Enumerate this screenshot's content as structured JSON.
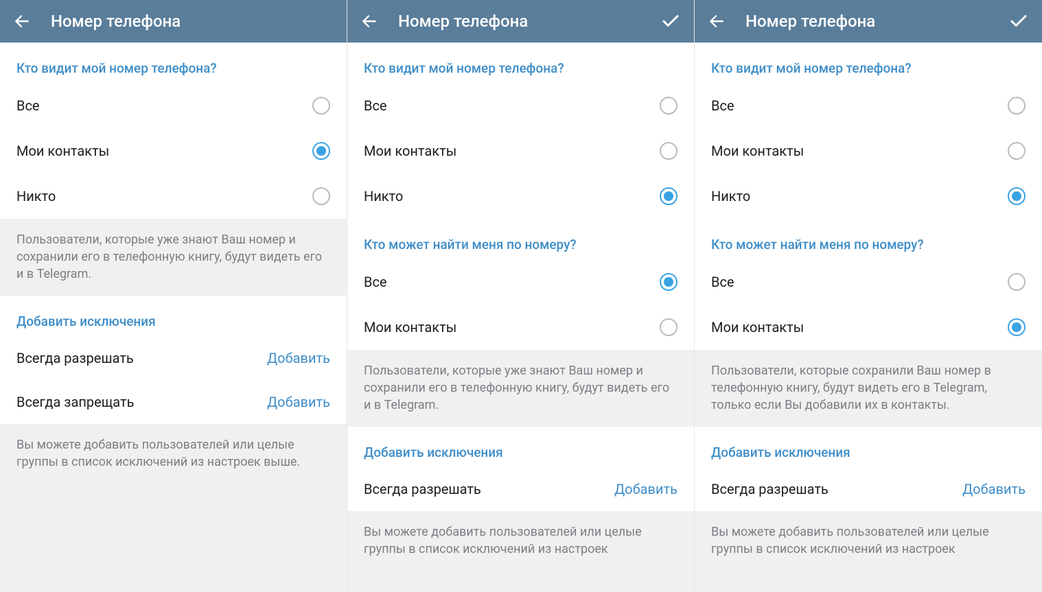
{
  "colors": {
    "header_bg": "#5a7d9a",
    "accent": "#3f8ec8",
    "radio_checked": "#3aa3e3",
    "muted_bg": "#f0f0f0",
    "muted_text": "#7b7f84",
    "text": "#1d1d1d"
  },
  "panels": [
    {
      "header": {
        "title": "Номер телефона",
        "show_check": false
      },
      "who_sees": {
        "title": "Кто видит мой номер телефона?",
        "options": [
          {
            "label": "Все",
            "checked": false
          },
          {
            "label": "Мои контакты",
            "checked": true
          },
          {
            "label": "Никто",
            "checked": false
          }
        ]
      },
      "info1": "Пользователи, которые уже знают Ваш номер и сохранили его в телефонную книгу, будут видеть его и в Telegram.",
      "exceptions": {
        "title": "Добавить исключения",
        "rows": [
          {
            "label": "Всегда разрешать",
            "action": "Добавить"
          },
          {
            "label": "Всегда запрещать",
            "action": "Добавить"
          }
        ]
      },
      "info2": "Вы можете добавить пользователей или целые группы в список исключений из настроек выше."
    },
    {
      "header": {
        "title": "Номер телефона",
        "show_check": true
      },
      "who_sees": {
        "title": "Кто видит мой номер телефона?",
        "options": [
          {
            "label": "Все",
            "checked": false
          },
          {
            "label": "Мои контакты",
            "checked": false
          },
          {
            "label": "Никто",
            "checked": true
          }
        ]
      },
      "who_finds": {
        "title": "Кто может найти меня по номеру?",
        "options": [
          {
            "label": "Все",
            "checked": true
          },
          {
            "label": "Мои контакты",
            "checked": false
          }
        ]
      },
      "info1": "Пользователи, которые уже знают Ваш номер и сохранили его в телефонную книгу, будут видеть его и в Telegram.",
      "exceptions": {
        "title": "Добавить исключения",
        "rows": [
          {
            "label": "Всегда разрешать",
            "action": "Добавить"
          }
        ]
      },
      "info2": "Вы можете добавить пользователей или целые группы в список исключений из настроек"
    },
    {
      "header": {
        "title": "Номер телефона",
        "show_check": true
      },
      "who_sees": {
        "title": "Кто видит мой номер телефона?",
        "options": [
          {
            "label": "Все",
            "checked": false
          },
          {
            "label": "Мои контакты",
            "checked": false
          },
          {
            "label": "Никто",
            "checked": true
          }
        ]
      },
      "who_finds": {
        "title": "Кто может найти меня по номеру?",
        "options": [
          {
            "label": "Все",
            "checked": false
          },
          {
            "label": "Мои контакты",
            "checked": true
          }
        ]
      },
      "info1": "Пользователи, которые сохранили Ваш номер в телефонную книгу, будут видеть его в Telegram, только если Вы добавили их в контакты.",
      "exceptions": {
        "title": "Добавить исключения",
        "rows": [
          {
            "label": "Всегда разрешать",
            "action": "Добавить"
          }
        ]
      },
      "info2": "Вы можете добавить пользователей или целые группы в список исключений из настроек"
    }
  ]
}
